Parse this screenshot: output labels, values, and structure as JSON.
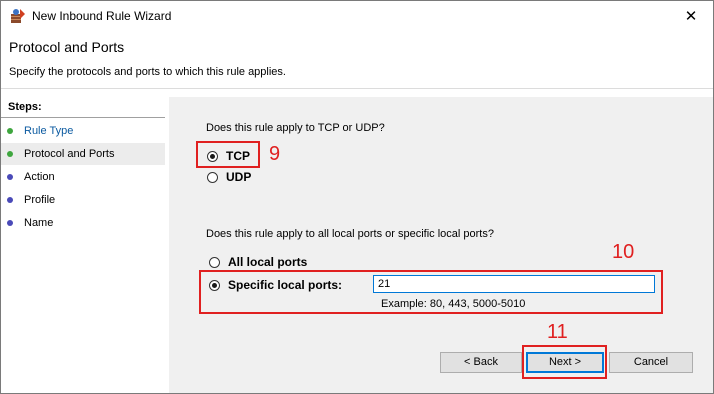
{
  "window": {
    "title": "New Inbound Rule Wizard",
    "close_glyph": "✕"
  },
  "header": {
    "title": "Protocol and Ports",
    "subtitle": "Specify the protocols and ports to which this rule applies."
  },
  "steps": {
    "heading": "Steps:",
    "items": [
      {
        "label": "Rule Type",
        "state": "done"
      },
      {
        "label": "Protocol and Ports",
        "state": "current"
      },
      {
        "label": "Action",
        "state": "pending"
      },
      {
        "label": "Profile",
        "state": "pending"
      },
      {
        "label": "Name",
        "state": "pending"
      }
    ]
  },
  "protocol": {
    "question": "Does this rule apply to TCP or UDP?",
    "options": [
      {
        "label": "TCP",
        "selected": true
      },
      {
        "label": "UDP",
        "selected": false
      }
    ]
  },
  "ports": {
    "question": "Does this rule apply to all local ports or specific local ports?",
    "options": [
      {
        "label": "All local ports",
        "selected": false
      },
      {
        "label": "Specific local ports:",
        "selected": true
      }
    ],
    "value": "21",
    "example": "Example: 80, 443, 5000-5010"
  },
  "buttons": {
    "back": "< Back",
    "next": "Next >",
    "cancel": "Cancel"
  },
  "annotations": {
    "tcp_marker": "9",
    "ports_marker": "10",
    "next_marker": "11"
  },
  "colors": {
    "annotation": "#e02020",
    "step_done": "#3ea63e",
    "step_pending": "#4a4ab8",
    "link": "#0b5aa0",
    "focus": "#0078d7"
  }
}
